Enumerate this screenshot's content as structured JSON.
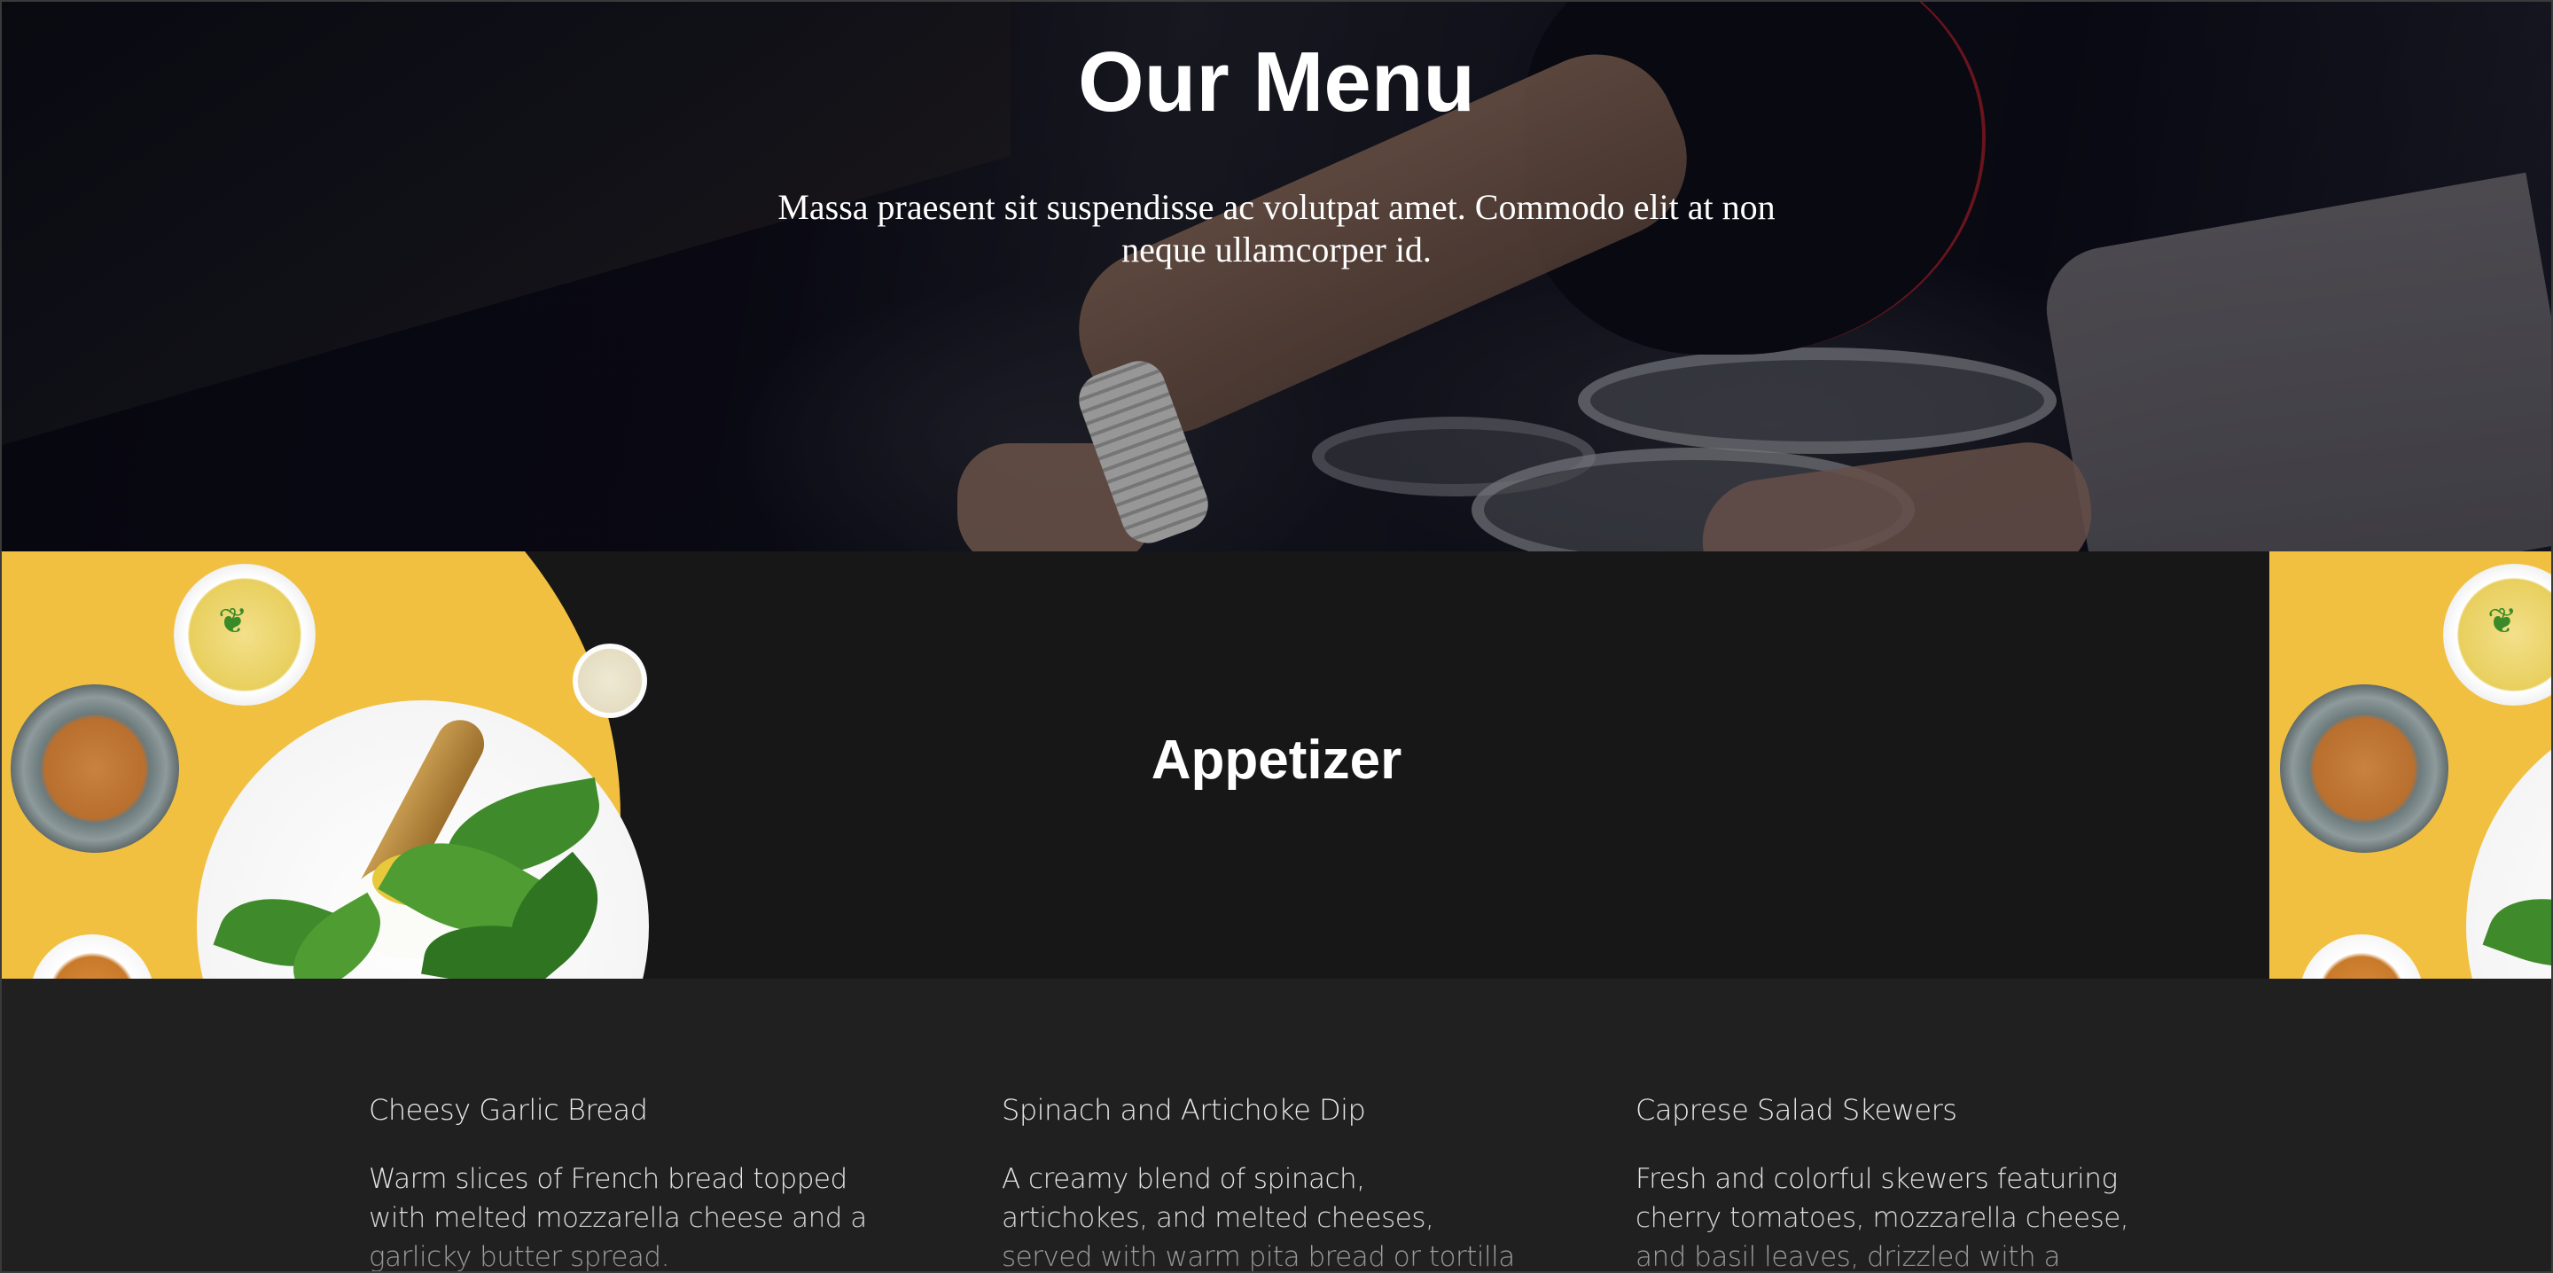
{
  "hero": {
    "title": "Our Menu",
    "subtitle": "Massa praesent sit suspendisse ac volutpat amet. Commodo elit at non neque ullamcorper id."
  },
  "category": {
    "title": "Appetizer",
    "accent_color": "#f1c040"
  },
  "menu_items": [
    {
      "name": "Cheesy Garlic Bread",
      "description": "Warm slices of French bread topped with melted mozzarella cheese and a garlicky butter spread."
    },
    {
      "name": "Spinach and Artichoke Dip",
      "description": "A creamy blend of spinach, artichokes, and melted cheeses, served with warm pita bread or tortilla chips."
    },
    {
      "name": "Caprese Salad Skewers",
      "description": "Fresh and colorful skewers featuring cherry tomatoes, mozzarella cheese, and basil leaves, drizzled with a balsamic glaze"
    }
  ],
  "colors": {
    "page_background": "#202020",
    "banner_background": "#171717",
    "text": "#ffffff"
  }
}
